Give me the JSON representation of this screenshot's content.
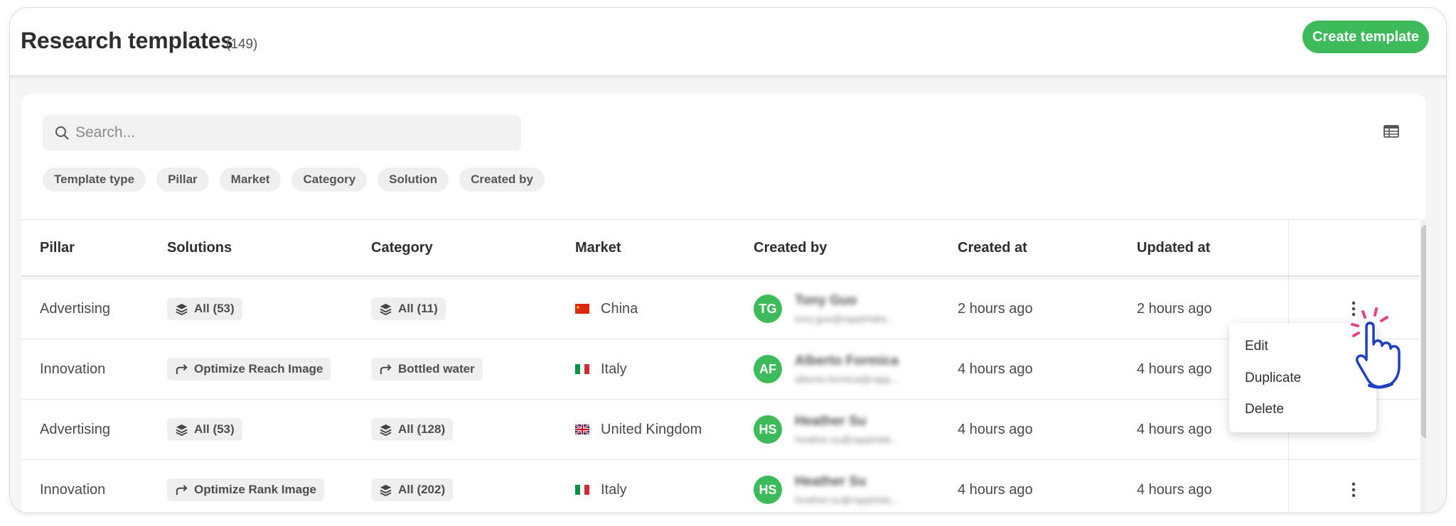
{
  "header": {
    "title": "Research templates",
    "count": "(149)",
    "create_button": "Create template"
  },
  "search": {
    "placeholder": "Search..."
  },
  "filters": [
    "Template type",
    "Pillar",
    "Market",
    "Category",
    "Solution",
    "Created by"
  ],
  "table": {
    "columns": {
      "pillar": "Pillar",
      "solutions": "Solutions",
      "category": "Category",
      "market": "Market",
      "created_by": "Created by",
      "created_at": "Created at",
      "updated_at": "Updated at"
    },
    "rows": [
      {
        "pillar": "Advertising",
        "solutions": {
          "icon": "layers-icon",
          "label": "All (53)"
        },
        "category": {
          "icon": "layers-icon",
          "label": "All (11)"
        },
        "market": {
          "flag": "china-flag",
          "name": "China"
        },
        "creator": {
          "initials": "TG",
          "name": "Tony Guo",
          "email": "tony.guo@rapptrlabs..."
        },
        "created_at": "2 hours ago",
        "updated_at": "2 hours ago"
      },
      {
        "pillar": "Innovation",
        "solutions": {
          "icon": "share-arrow-icon",
          "label": "Optimize Reach Image"
        },
        "category": {
          "icon": "share-arrow-icon",
          "label": "Bottled water"
        },
        "market": {
          "flag": "italy-flag",
          "name": "Italy"
        },
        "creator": {
          "initials": "AF",
          "name": "Alberto Formica",
          "email": "alberto.formica@rapp..."
        },
        "created_at": "4 hours ago",
        "updated_at": "4 hours ago"
      },
      {
        "pillar": "Advertising",
        "solutions": {
          "icon": "layers-icon",
          "label": "All (53)"
        },
        "category": {
          "icon": "layers-icon",
          "label": "All (128)"
        },
        "market": {
          "flag": "uk-flag",
          "name": "United Kingdom"
        },
        "creator": {
          "initials": "HS",
          "name": "Heather Su",
          "email": "heather.su@rapptrlab..."
        },
        "created_at": "4 hours ago",
        "updated_at": "4 hours ago"
      },
      {
        "pillar": "Innovation",
        "solutions": {
          "icon": "share-arrow-icon",
          "label": "Optimize Rank Image"
        },
        "category": {
          "icon": "layers-icon",
          "label": "All (202)"
        },
        "market": {
          "flag": "italy-flag",
          "name": "Italy"
        },
        "creator": {
          "initials": "HS",
          "name": "Heather Su",
          "email": "heather.su@rapptrlab..."
        },
        "created_at": "4 hours ago",
        "updated_at": "4 hours ago"
      }
    ]
  },
  "context_menu": {
    "items": [
      "Edit",
      "Duplicate",
      "Delete"
    ]
  },
  "colors": {
    "accent": "#3dbb5a",
    "cursor_highlight": "#e8457a",
    "cursor_outline": "#1e3fc4"
  }
}
